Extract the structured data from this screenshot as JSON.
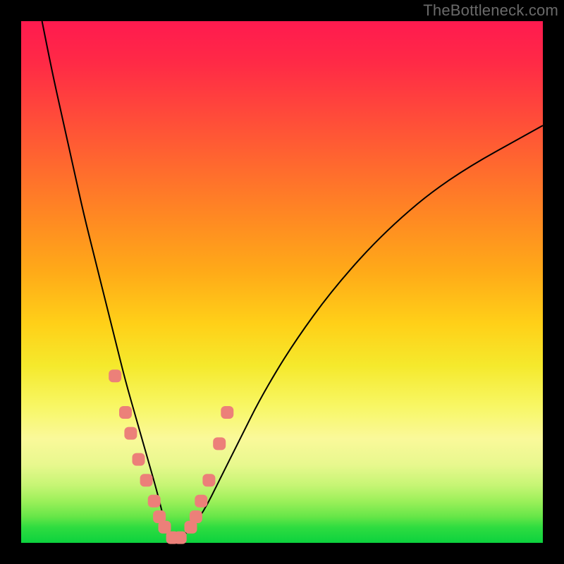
{
  "watermark": "TheBottleneck.com",
  "colors": {
    "marker": "#ec8079",
    "curve": "#000000",
    "frame": "#000000"
  },
  "chart_data": {
    "type": "line",
    "title": "",
    "xlabel": "",
    "ylabel": "",
    "xlim": [
      0,
      100
    ],
    "ylim": [
      0,
      100
    ],
    "grid": false,
    "legend": false,
    "annotations": [
      "TheBottleneck.com"
    ],
    "series": [
      {
        "name": "bottleneck-curve",
        "x": [
          4,
          6,
          8,
          10,
          12,
          14,
          16,
          18,
          20,
          22,
          24,
          26,
          27,
          28,
          29,
          30,
          32,
          35,
          38,
          42,
          46,
          52,
          60,
          70,
          82,
          100
        ],
        "y": [
          100,
          90,
          81,
          72,
          63,
          55,
          47,
          39,
          31,
          24,
          17,
          10,
          6,
          2,
          1,
          1,
          2,
          6,
          12,
          20,
          28,
          38,
          49,
          60,
          70,
          80
        ],
        "note": "V-shaped curve; minimum near x≈29, y≈1. Values estimated from pixel positions on a 0–100 axis."
      }
    ],
    "markers": {
      "name": "highlighted-points",
      "shape": "rounded-square",
      "x": [
        18,
        20,
        21,
        22.5,
        24,
        25.5,
        26.5,
        27.5,
        29,
        30.5,
        32.5,
        33.5,
        34.5,
        36,
        38,
        39.5
      ],
      "y": [
        32,
        25,
        21,
        16,
        12,
        8,
        5,
        3,
        1,
        1,
        3,
        5,
        8,
        12,
        19,
        25
      ],
      "note": "Salmon rounded markers clustered around the minimum of the curve."
    }
  }
}
